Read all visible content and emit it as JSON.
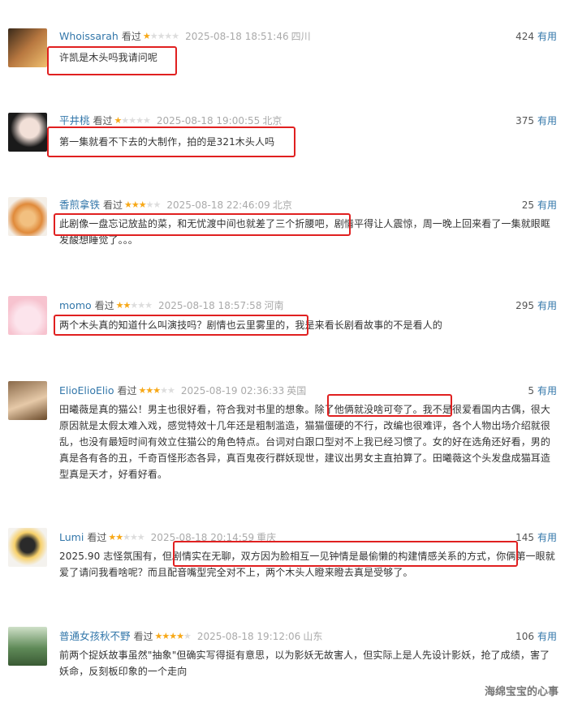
{
  "colors": {
    "accent": "#3377aa",
    "highlight": "#e02020",
    "star": "#f7a817"
  },
  "useful_label": "有用",
  "watched_label": "看过",
  "reviews": [
    {
      "user": "Whoissarah",
      "stars": 1,
      "time": "2025-08-18 18:51:46",
      "loc": "四川",
      "votes": "424",
      "content": "许凯是木头吗我请问呢"
    },
    {
      "user": "平井桃",
      "stars": 1,
      "time": "2025-08-18 19:00:55",
      "loc": "北京",
      "votes": "375",
      "content": "第一集就看不下去的大制作，拍的是321木头人吗"
    },
    {
      "user": "香煎拿铁",
      "stars": 3,
      "time": "2025-08-18 22:46:09",
      "loc": "北京",
      "votes": "25",
      "content": "此剧像一盘忘记放盐的菜，和无忧渡中间也就差了三个折腰吧，剧情平得让人震惊，周一晚上回来看了一集就眼眶发酸想睡觉了。。。"
    },
    {
      "user": "momo",
      "stars": 2,
      "time": "2025-08-18 18:57:58",
      "loc": "河南",
      "votes": "295",
      "content": "两个木头真的知道什么叫演技吗？剧情也云里雾里的，我是来看长剧看故事的不是看人的"
    },
    {
      "user": "ElioElioElio",
      "stars": 3,
      "time": "2025-08-19 02:36:33",
      "loc": "英国",
      "votes": "5",
      "content": "田曦薇是真的猫公！男主也很好看，符合我对书里的想象。除了他俩就没啥可夸了。我不是很爱看国内古偶，很大原因就是太假太难入戏，感觉特效十几年还是粗制滥造，猫猫僵硬的不行，改编也很难评，各个人物出场介绍就很乱，也没有最短时间有效立住猫公的角色特点。台词对白跟口型对不上我已经习惯了。女的好在选角还好看，男的真是各有各的丑，千奇百怪形态各异，真百鬼夜行群妖现世，建议出男女主直拍算了。田曦薇这个头发盘成猫耳造型真是天才，好看好看。"
    },
    {
      "user": "Lumi",
      "stars": 2,
      "time": "2025-08-18 20:14:59",
      "loc": "重庆",
      "votes": "145",
      "content": "2025.90 志怪氛围有，但剧情实在无聊，双方因为脸相互一见钟情是最偷懒的构建情感关系的方式，你俩第一眼就爱了请问我看啥呢？而且配音嘴型完全对不上，两个木头人瞪来瞪去真是受够了。"
    },
    {
      "user": "普通女孩秋不野",
      "stars": 4,
      "time": "2025-08-18 19:12:06",
      "loc": "山东",
      "votes": "106",
      "content": "前两个捉妖故事虽然\"抽象\"但确实写得挺有意思，以为影妖无故害人，但实际上是人先设计影妖，抢了成绩，害了妖命，反刻板印象的一个走向"
    }
  ],
  "watermark": "海绵宝宝的心事"
}
